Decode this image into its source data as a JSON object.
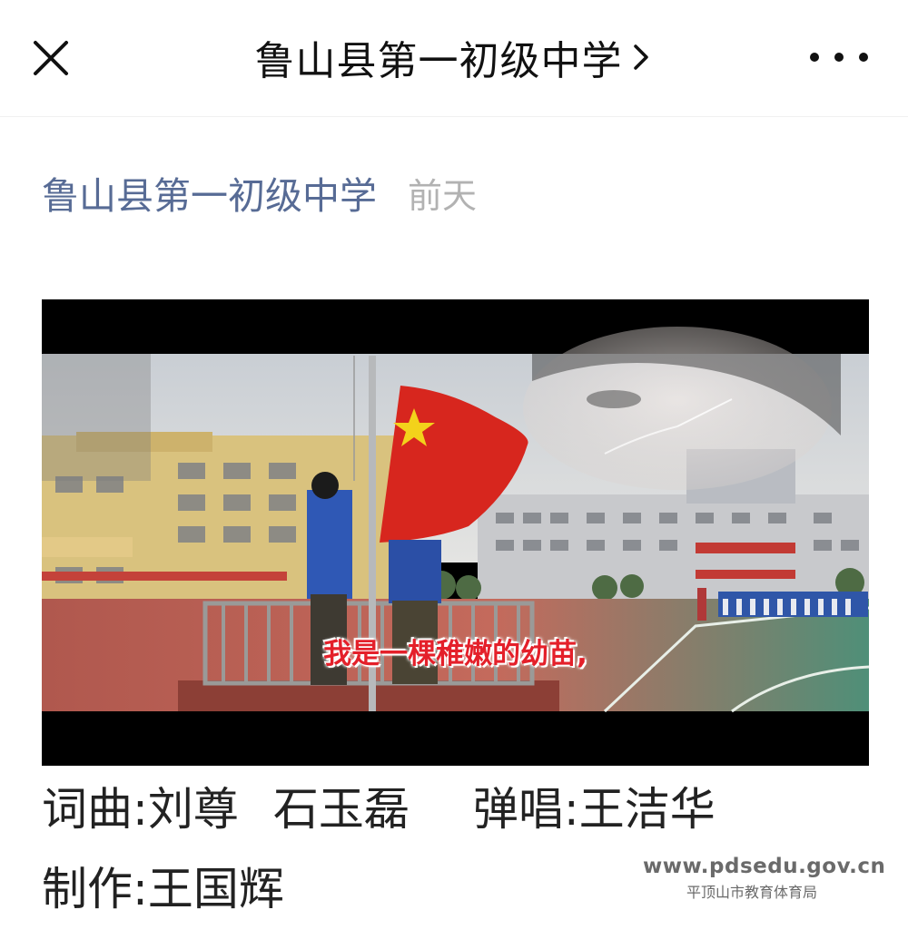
{
  "topbar": {
    "title": "鲁山县第一初级中学",
    "close_icon": "close-icon",
    "chevron_icon": "chevron-right-icon",
    "more_icon": "more-horizontal-icon"
  },
  "post": {
    "account_name": "鲁山县第一初级中学",
    "time": "前天"
  },
  "video": {
    "subtitle": "我是一棵稚嫩的幼苗,"
  },
  "credits": {
    "lyrics_label": "词曲:",
    "lyrics_names": "刘尊",
    "lyrics_names2": "石玉磊",
    "singer_label": "弹唱:",
    "singer_name": "王洁华",
    "producer_label": "制作:",
    "producer_name": "王国辉"
  },
  "watermark": {
    "url": "www.pdsedu.gov.cn",
    "org": "平顶山市教育体育局"
  },
  "colors": {
    "link_blue": "#576b95",
    "muted_gray": "#b2b2b2",
    "flag_red": "#d7261e",
    "subtitle_red": "#e4202a"
  }
}
